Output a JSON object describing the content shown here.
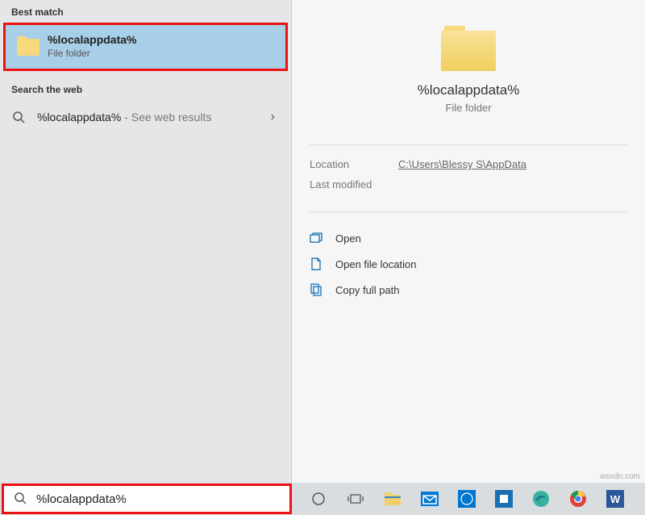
{
  "left": {
    "best_match_header": "Best match",
    "result_title": "%localappdata%",
    "result_sub": "File folder",
    "web_header": "Search the web",
    "web_query": "%localappdata%",
    "web_suffix": " - See web results"
  },
  "preview": {
    "title": "%localappdata%",
    "sub": "File folder",
    "location_label": "Location",
    "location_value": "C:\\Users\\Blessy S\\AppData",
    "modified_label": "Last modified",
    "modified_value": ""
  },
  "actions": {
    "open": "Open",
    "open_location": "Open file location",
    "copy_path": "Copy full path"
  },
  "search": {
    "value": "%localappdata%"
  },
  "watermark": "wsxdn.com"
}
